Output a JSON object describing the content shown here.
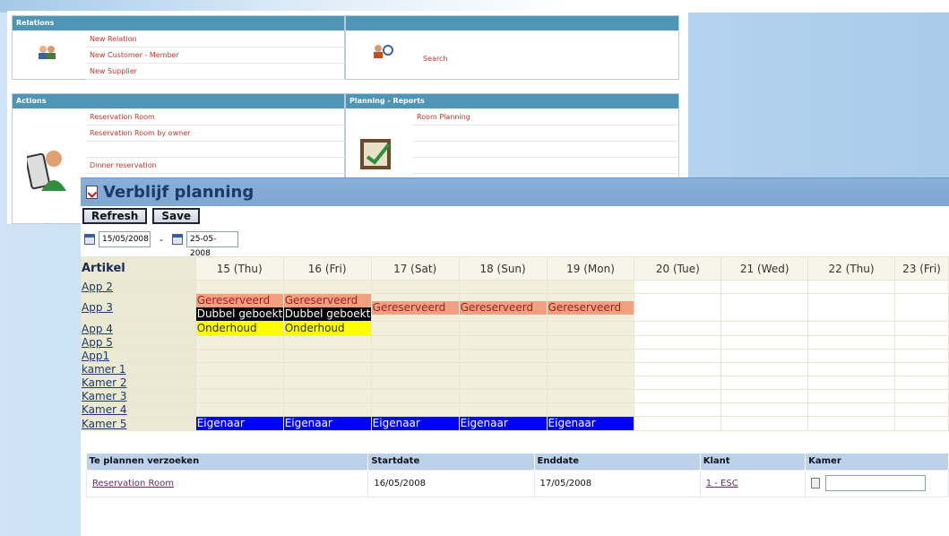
{
  "back": {
    "relations": {
      "header": "Relations",
      "items": [
        "New Relation",
        "New Customer - Member",
        "New Supplier"
      ],
      "search": "Search"
    },
    "actions": {
      "header": "Actions",
      "items": [
        "Reservation Room",
        "Reservation Room by owner",
        "",
        "Dinner reservation"
      ]
    },
    "planning": {
      "header": "Planning - Reports",
      "items": [
        "Room Planning",
        "",
        "",
        ""
      ]
    }
  },
  "window": {
    "title": "Verblijf planning"
  },
  "buttons": {
    "refresh": "Refresh",
    "save": "Save"
  },
  "dates": {
    "from": "15/05/2008",
    "to": "25-05-2008",
    "separator": "-"
  },
  "grid": {
    "article_header": "Artikel",
    "days": [
      "15 (Thu)",
      "16 (Fri)",
      "17 (Sat)",
      "18 (Sun)",
      "19 (Mon)",
      "20 (Tue)",
      "21 (Wed)",
      "22 (Thu)",
      "23 (Fri)"
    ],
    "rows": [
      {
        "name": "App 2"
      },
      {
        "name": "App 3"
      },
      {
        "name": "App 4"
      },
      {
        "name": "App 5"
      },
      {
        "name": "App1"
      },
      {
        "name": "kamer 1"
      },
      {
        "name": "Kamer 2"
      },
      {
        "name": "Kamer 3"
      },
      {
        "name": "Kamer 4"
      },
      {
        "name": "Kamer 5"
      }
    ],
    "labels": {
      "reserved": "Gereserveerd",
      "double": "Dubbel geboekt",
      "maintenance": "Onderhoud",
      "owner": "Eigenaar"
    }
  },
  "requests": {
    "headers": [
      "Te plannen verzoeken",
      "Startdate",
      "Enddate",
      "Klant",
      "Kamer"
    ],
    "rows": [
      {
        "request": "Reservation Room",
        "start": "16/05/2008",
        "end": "17/05/2008",
        "client": "1 - ESC"
      }
    ]
  },
  "colors": {
    "reserved": "#f3a080",
    "double": "#000000",
    "maintenance": "#ffff00",
    "owner": "#0000ff",
    "header": "#4f95b5"
  }
}
